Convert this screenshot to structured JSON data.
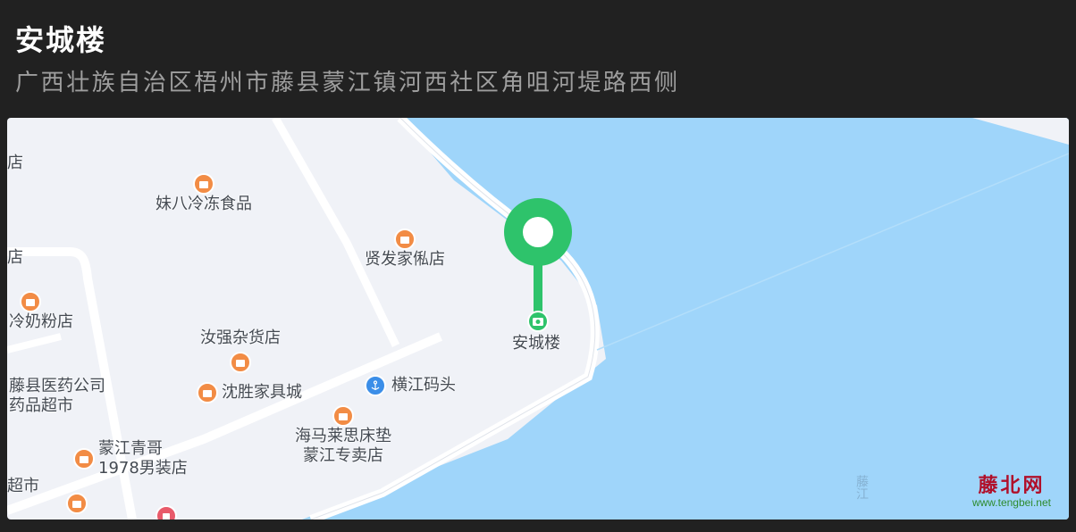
{
  "header": {
    "title": "安城楼",
    "address": "广西壮族自治区梧州市藤县蒙江镇河西社区角咀河堤路西侧"
  },
  "map": {
    "marker_label": "安城楼",
    "pois": [
      {
        "label": "妹八冷冻食品"
      },
      {
        "label": "贤发家俬店"
      },
      {
        "label": "汝强杂货店"
      },
      {
        "label": "沈胜家具城"
      },
      {
        "label": "横江码头"
      },
      {
        "label": "海马莱思床垫"
      },
      {
        "label": "蒙江专卖店"
      },
      {
        "label": "藤县医药公司"
      },
      {
        "label": "药品超市"
      },
      {
        "label": "蒙江青哥"
      },
      {
        "label": "1978男装店"
      },
      {
        "label": "冷奶粉店"
      },
      {
        "label": "店"
      },
      {
        "label": "超市"
      },
      {
        "label": "店"
      }
    ],
    "water_label": "藤江"
  },
  "watermark": {
    "name": "藤北网",
    "url": "www.tengbei.net"
  },
  "colors": {
    "background": "#212121",
    "land": "#f0f2f7",
    "water": "#9fd5fa",
    "marker": "#2ec36b",
    "poi": "#f28c45",
    "anchor": "#3b8ee8"
  }
}
